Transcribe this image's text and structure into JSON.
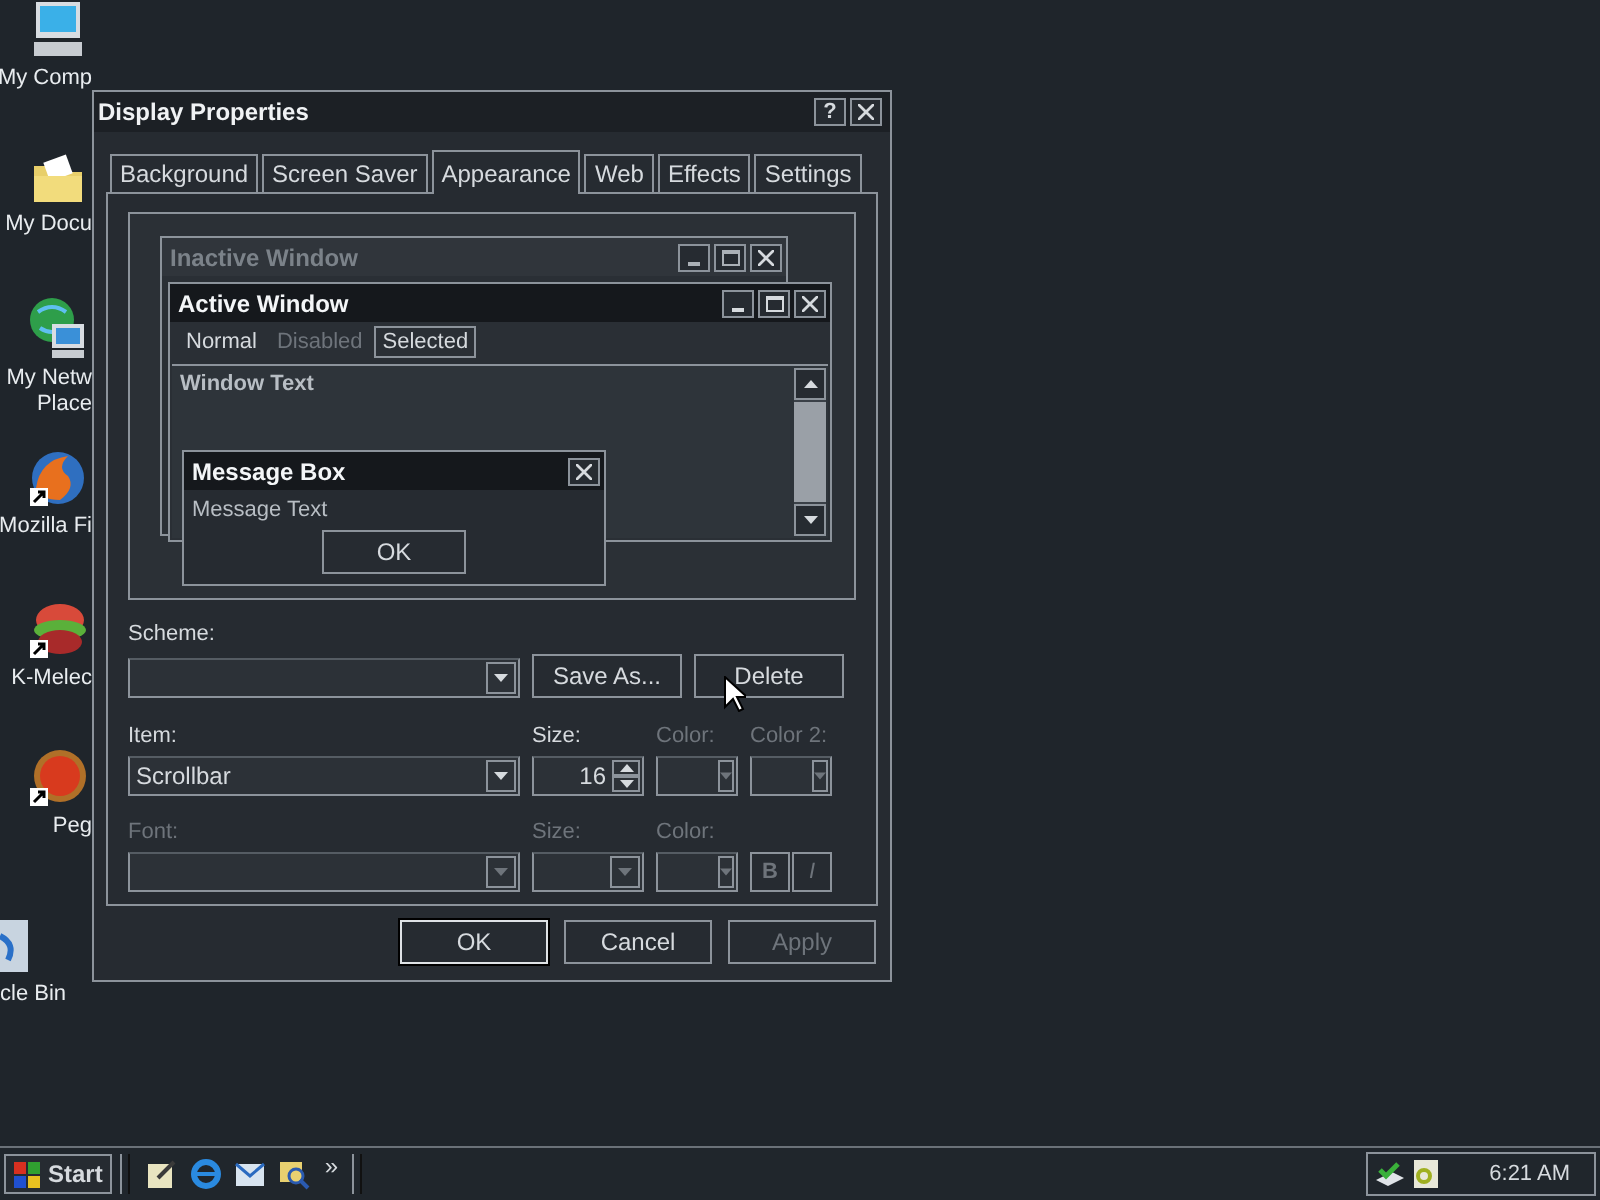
{
  "desktop_icons": [
    {
      "kind": "computer",
      "shortcut": false,
      "lines": [
        "My Comp"
      ]
    },
    {
      "kind": "folder",
      "shortcut": false,
      "lines": [
        "My Docu"
      ]
    },
    {
      "kind": "network",
      "shortcut": false,
      "lines": [
        "My Netw",
        "Place"
      ]
    },
    {
      "kind": "fox",
      "shortcut": true,
      "lines": [
        "Mozilla Fi"
      ]
    },
    {
      "kind": "melon",
      "shortcut": true,
      "lines": [
        "K-Melec"
      ]
    },
    {
      "kind": "ball",
      "shortcut": true,
      "lines": [
        "Peg"
      ]
    },
    {
      "kind": "bin",
      "shortcut": false,
      "lines": [
        "cle Bin"
      ]
    }
  ],
  "dialog": {
    "title": "Display Properties",
    "help_button": "?",
    "tabs": [
      {
        "label": "Background",
        "selected": false
      },
      {
        "label": "Screen Saver",
        "selected": false
      },
      {
        "label": "Appearance",
        "selected": true
      },
      {
        "label": "Web",
        "selected": false
      },
      {
        "label": "Effects",
        "selected": false
      },
      {
        "label": "Settings",
        "selected": false
      }
    ],
    "preview": {
      "inactive_title": "Inactive Window",
      "active_title": "Active Window",
      "menu": [
        {
          "label": "Normal",
          "disabled": false,
          "selected": false
        },
        {
          "label": "Disabled",
          "disabled": true,
          "selected": false
        },
        {
          "label": "Selected",
          "disabled": false,
          "selected": true
        }
      ],
      "window_text": "Window Text",
      "message_box": {
        "title": "Message Box",
        "text": "Message Text",
        "button": "OK"
      }
    },
    "scheme": {
      "label": "Scheme:",
      "buttons": [
        {
          "label": "Save As...",
          "disabled": false
        },
        {
          "label": "Delete",
          "disabled": false
        }
      ]
    },
    "item_row": [
      {
        "kind": "combo",
        "label": "Item:",
        "value": "Scrollbar",
        "disabled": false
      },
      {
        "kind": "spin",
        "label": "Size:",
        "value": "16",
        "disabled": false
      },
      {
        "kind": "color",
        "label": "Color:",
        "disabled": true
      },
      {
        "kind": "color",
        "label": "Color 2:",
        "disabled": true
      }
    ],
    "font_row": [
      {
        "kind": "combo",
        "label": "Font:",
        "disabled": true
      },
      {
        "kind": "smallcombo",
        "label": "Size:",
        "disabled": true
      },
      {
        "kind": "color",
        "label": "Color:",
        "disabled": true
      }
    ],
    "style_buttons": [
      {
        "label": "B",
        "kind": "bold",
        "disabled": true
      },
      {
        "label": "I",
        "kind": "italic",
        "disabled": true
      }
    ],
    "buttons": [
      {
        "label": "OK",
        "default": true,
        "disabled": false
      },
      {
        "label": "Cancel",
        "default": false,
        "disabled": false
      },
      {
        "label": "Apply",
        "default": false,
        "disabled": true
      }
    ]
  },
  "taskbar": {
    "start": "Start",
    "quick_launch": [
      {
        "kind": "notepad"
      },
      {
        "kind": "browser"
      },
      {
        "kind": "mail"
      },
      {
        "kind": "search"
      }
    ],
    "chevron": "»",
    "tray": [
      {
        "kind": "network"
      },
      {
        "kind": "doc"
      }
    ],
    "clock": "6:21 AM"
  }
}
